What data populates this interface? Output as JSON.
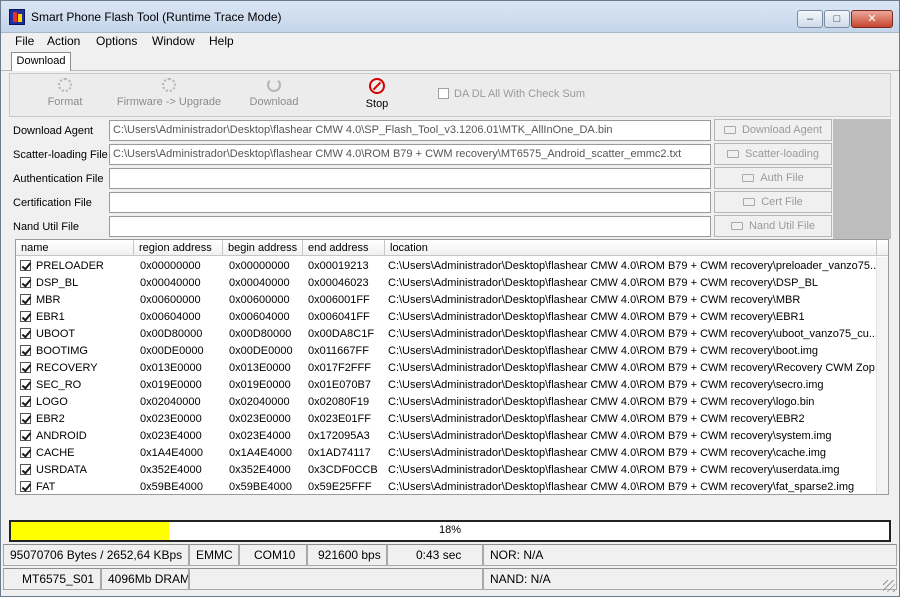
{
  "window": {
    "title": "Smart Phone Flash Tool (Runtime Trace Mode)"
  },
  "menu": [
    "File",
    "Action",
    "Options",
    "Window",
    "Help"
  ],
  "tab": "Download",
  "toolbar": {
    "format": "Format",
    "firmware_upgrade": "Firmware -> Upgrade",
    "download": "Download",
    "stop": "Stop",
    "da_checksum": "DA DL All With Check Sum"
  },
  "files": [
    {
      "label": "Download Agent",
      "value": "C:\\Users\\Administrador\\Desktop\\flashear CMW 4.0\\SP_Flash_Tool_v3.1206.01\\MTK_AllInOne_DA.bin",
      "button": "Download Agent"
    },
    {
      "label": "Scatter-loading File",
      "value": "C:\\Users\\Administrador\\Desktop\\flashear CMW 4.0\\ROM B79 + CWM recovery\\MT6575_Android_scatter_emmc2.txt",
      "button": "Scatter-loading"
    },
    {
      "label": "Authentication File",
      "value": "",
      "button": "Auth File"
    },
    {
      "label": "Certification File",
      "value": "",
      "button": "Cert File"
    },
    {
      "label": "Nand Util File",
      "value": "",
      "button": "Nand Util File"
    }
  ],
  "table": {
    "headers": [
      "name",
      "region address",
      "begin address",
      "end address",
      "location"
    ],
    "rows": [
      {
        "name": "PRELOADER",
        "region": "0x00000000",
        "begin": "0x00000000",
        "end": "0x00019213",
        "location": "C:\\Users\\Administrador\\Desktop\\flashear CMW 4.0\\ROM B79 + CWM recovery\\preloader_vanzo75..."
      },
      {
        "name": "DSP_BL",
        "region": "0x00040000",
        "begin": "0x00040000",
        "end": "0x00046023",
        "location": "C:\\Users\\Administrador\\Desktop\\flashear CMW 4.0\\ROM B79 + CWM recovery\\DSP_BL"
      },
      {
        "name": "MBR",
        "region": "0x00600000",
        "begin": "0x00600000",
        "end": "0x006001FF",
        "location": "C:\\Users\\Administrador\\Desktop\\flashear CMW 4.0\\ROM B79 + CWM recovery\\MBR"
      },
      {
        "name": "EBR1",
        "region": "0x00604000",
        "begin": "0x00604000",
        "end": "0x006041FF",
        "location": "C:\\Users\\Administrador\\Desktop\\flashear CMW 4.0\\ROM B79 + CWM recovery\\EBR1"
      },
      {
        "name": "UBOOT",
        "region": "0x00D80000",
        "begin": "0x00D80000",
        "end": "0x00DA8C1F",
        "location": "C:\\Users\\Administrador\\Desktop\\flashear CMW 4.0\\ROM B79 + CWM recovery\\uboot_vanzo75_cu..."
      },
      {
        "name": "BOOTIMG",
        "region": "0x00DE0000",
        "begin": "0x00DE0000",
        "end": "0x011667FF",
        "location": "C:\\Users\\Administrador\\Desktop\\flashear CMW 4.0\\ROM B79 + CWM recovery\\boot.img"
      },
      {
        "name": "RECOVERY",
        "region": "0x013E0000",
        "begin": "0x013E0000",
        "end": "0x017F2FFF",
        "location": "C:\\Users\\Administrador\\Desktop\\flashear CMW 4.0\\ROM B79 + CWM recovery\\Recovery CWM Zop..."
      },
      {
        "name": "SEC_RO",
        "region": "0x019E0000",
        "begin": "0x019E0000",
        "end": "0x01E070B7",
        "location": "C:\\Users\\Administrador\\Desktop\\flashear CMW 4.0\\ROM B79 + CWM recovery\\secro.img"
      },
      {
        "name": "LOGO",
        "region": "0x02040000",
        "begin": "0x02040000",
        "end": "0x02080F19",
        "location": "C:\\Users\\Administrador\\Desktop\\flashear CMW 4.0\\ROM B79 + CWM recovery\\logo.bin"
      },
      {
        "name": "EBR2",
        "region": "0x023E0000",
        "begin": "0x023E0000",
        "end": "0x023E01FF",
        "location": "C:\\Users\\Administrador\\Desktop\\flashear CMW 4.0\\ROM B79 + CWM recovery\\EBR2"
      },
      {
        "name": "ANDROID",
        "region": "0x023E4000",
        "begin": "0x023E4000",
        "end": "0x172095A3",
        "location": "C:\\Users\\Administrador\\Desktop\\flashear CMW 4.0\\ROM B79 + CWM recovery\\system.img"
      },
      {
        "name": "CACHE",
        "region": "0x1A4E4000",
        "begin": "0x1A4E4000",
        "end": "0x1AD74117",
        "location": "C:\\Users\\Administrador\\Desktop\\flashear CMW 4.0\\ROM B79 + CWM recovery\\cache.img"
      },
      {
        "name": "USRDATA",
        "region": "0x352E4000",
        "begin": "0x352E4000",
        "end": "0x3CDF0CCB",
        "location": "C:\\Users\\Administrador\\Desktop\\flashear CMW 4.0\\ROM B79 + CWM recovery\\userdata.img"
      },
      {
        "name": "FAT",
        "region": "0x59BE4000",
        "begin": "0x59BE4000",
        "end": "0x59E25FFF",
        "location": "C:\\Users\\Administrador\\Desktop\\flashear CMW 4.0\\ROM B79 + CWM recovery\\fat_sparse2.img"
      }
    ]
  },
  "progress": {
    "fraction": 0.18,
    "text": "18%",
    "color": "#ffff00"
  },
  "status": {
    "bytes": "95070706 Bytes / 2652,64 KBps",
    "type": "EMMC",
    "port": "COM10",
    "baud": "921600 bps",
    "time": "0:43 sec",
    "nor": "NOR: N/A",
    "chip": "MT6575_S01",
    "dram": "4096Mb DRAM",
    "nand": "NAND: N/A"
  }
}
